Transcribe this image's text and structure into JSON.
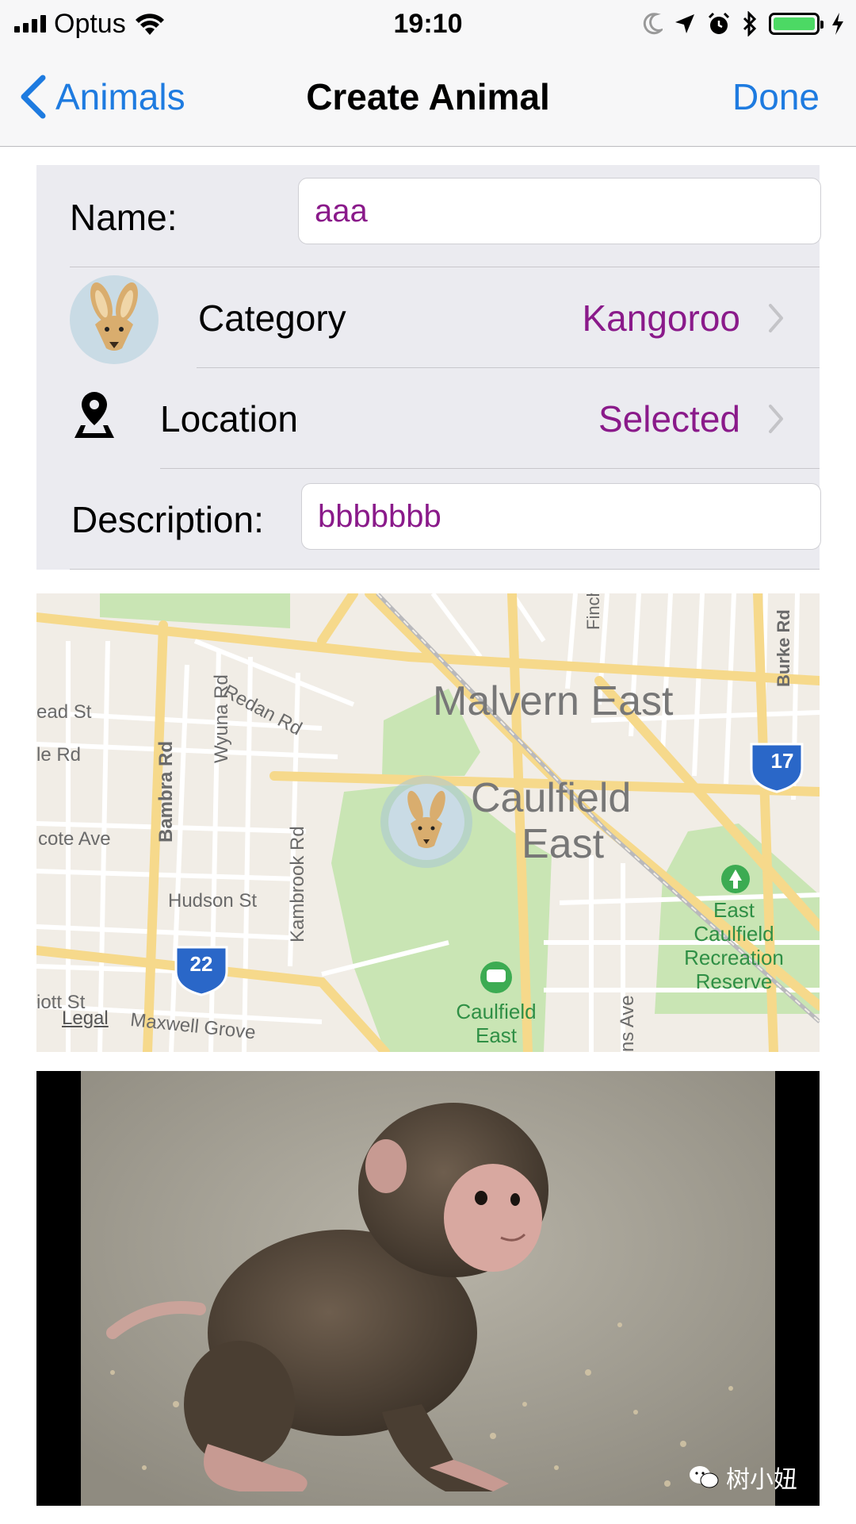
{
  "status_bar": {
    "carrier": "Optus",
    "time": "19:10"
  },
  "nav": {
    "back_label": "Animals",
    "title": "Create Animal",
    "done_label": "Done",
    "accent_color": "#1e7be0"
  },
  "form": {
    "name_label": "Name:",
    "name_value": "aaa",
    "category_label": "Category",
    "category_value": "Kangoroo",
    "location_label": "Location",
    "location_value": "Selected",
    "description_label": "Description:",
    "description_value": "bbbbbbb",
    "value_color": "#8a1a8a"
  },
  "map": {
    "labels": {
      "malvern_east": "Malvern East",
      "caulfield_east": "Caulfield",
      "caulfield_east_2": "East",
      "redan_rd": "Redan Rd",
      "wyuna_rd": "Wyuna Rd",
      "bambra_rd": "Bambra Rd",
      "kambrook_rd": "Kambrook Rd",
      "hudson_st": "Hudson St",
      "maxwell_grove": "Maxwell Grove",
      "burke_rd": "Burke Rd",
      "finch": "Finch",
      "ead_st": "ead St",
      "le_rd": "le Rd",
      "cote_ave": "cote Ave",
      "iott_st": "iott St",
      "ns_ave": "ns Ave",
      "route_17": "17",
      "route_22": "22",
      "reserve": "East Caulfield Recreation Reserve",
      "station": "Caulfield East"
    },
    "legal": "Legal"
  },
  "watermark": {
    "text": "树小妞"
  }
}
